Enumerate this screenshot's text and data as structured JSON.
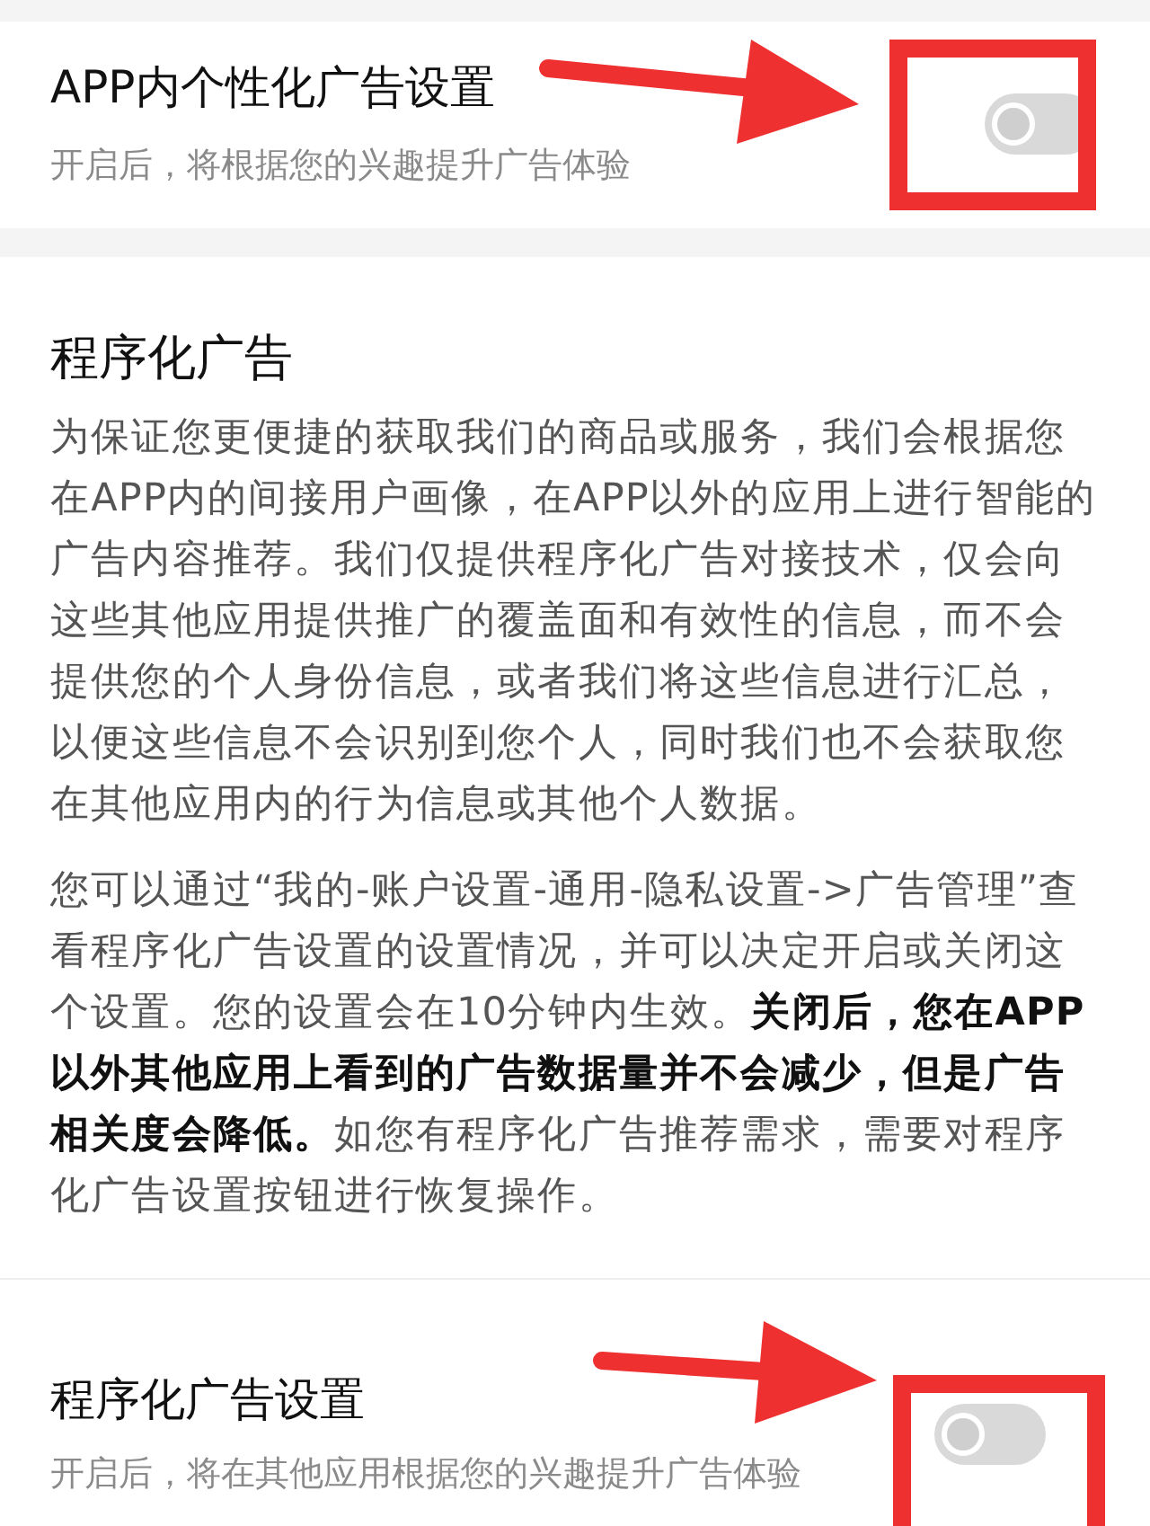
{
  "settings": [
    {
      "title": "APP内个性化广告设置",
      "subtitle": "开启后，将根据您的兴趣提升广告体验",
      "on": false
    }
  ],
  "section": {
    "heading": "程序化广告",
    "paragraphs": [
      "为保证您更便捷的获取我们的商品或服务，我们会根据您在APP内的间接用户画像，在APP以外的应用上进行智能的广告内容推荐。我们仅提供程序化广告对接技术，仅会向这些其他应用提供推广的覆盖面和有效性的信息，而不会提供您的个人身份信息，或者我们将这些信息进行汇总，以便这些信息不会识别到您个人，同时我们也不会获取您在其他应用内的行为信息或其他个人数据。",
      "您可以通过“我的-账户设置-通用-隐私设置->广告管理”查看程序化广告设置的设置情况，并可以决定开启或关闭这个设置。您的设置会在10分钟内生效。**关闭后，您在APP以外其他应用上看到的广告数据量并不会减少，但是广告相关度会降低。**如您有程序化广告推荐需求，需要对程序化广告设置按钮进行恢复操作。"
    ]
  },
  "bottom_setting": {
    "title": "程序化广告设置",
    "subtitle": "开启后，将在其他应用根据您的兴趣提升广告体验",
    "on": false
  }
}
